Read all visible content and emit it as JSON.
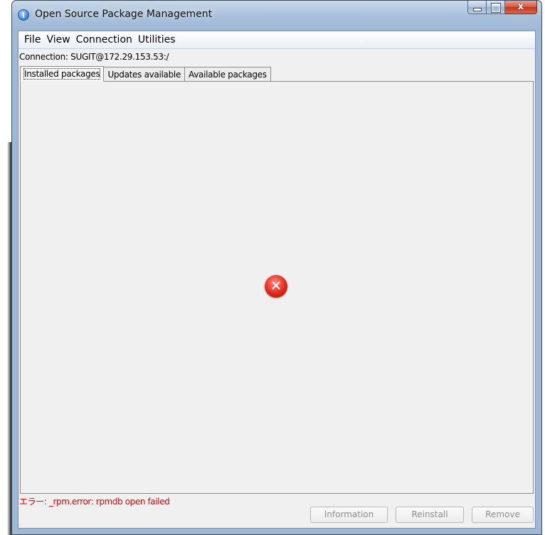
{
  "window": {
    "title": "Open Source Package Management",
    "close_glyph": "x"
  },
  "menubar": {
    "items": [
      "File",
      "View",
      "Connection",
      "Utilities"
    ]
  },
  "connection": {
    "label": "Connection: SUGIT@172.29.153.53:/"
  },
  "tabs": [
    {
      "label": "Installed packages",
      "active": true
    },
    {
      "label": "Updates available",
      "active": false
    },
    {
      "label": "Available packages",
      "active": false
    }
  ],
  "status": {
    "icon": "error-icon",
    "glyph": "✕",
    "message": "エラー:  _rpm.error: rpmdb open failed",
    "color": "#e00000"
  },
  "buttons": {
    "information": "Information",
    "reinstall": "Reinstall",
    "remove": "Remove"
  }
}
